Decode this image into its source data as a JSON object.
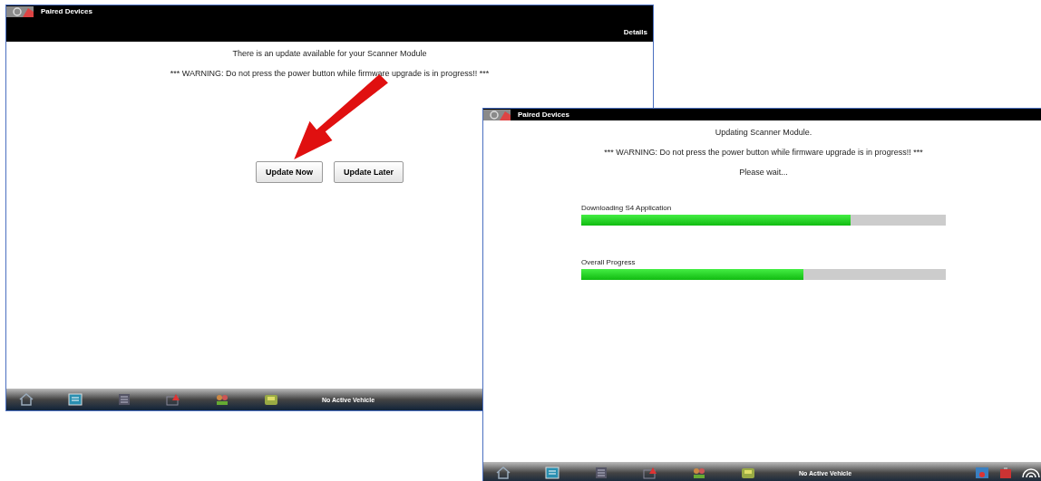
{
  "windows": [
    {
      "kind": "prompt",
      "title": "Paired Devices",
      "details": "Details",
      "message": "There is an update available for your Scanner Module",
      "warning": "*** WARNING: Do not press the power button while firmware upgrade is in progress!! ***",
      "buttons": [
        "Update Now",
        "Update Later"
      ],
      "status": "No Active Vehicle"
    },
    {
      "kind": "progress",
      "title": "Paired Devices",
      "message": "Updating Scanner Module.",
      "warning": "*** WARNING: Do not press the power button while firmware upgrade is in progress!! ***",
      "wait": "Please wait...",
      "progress": [
        {
          "label": "Downloading S4 Application",
          "level": 0.74
        },
        {
          "label": "Overall Progress",
          "level": 0.61
        }
      ],
      "status": "No Active Vehicle"
    }
  ]
}
